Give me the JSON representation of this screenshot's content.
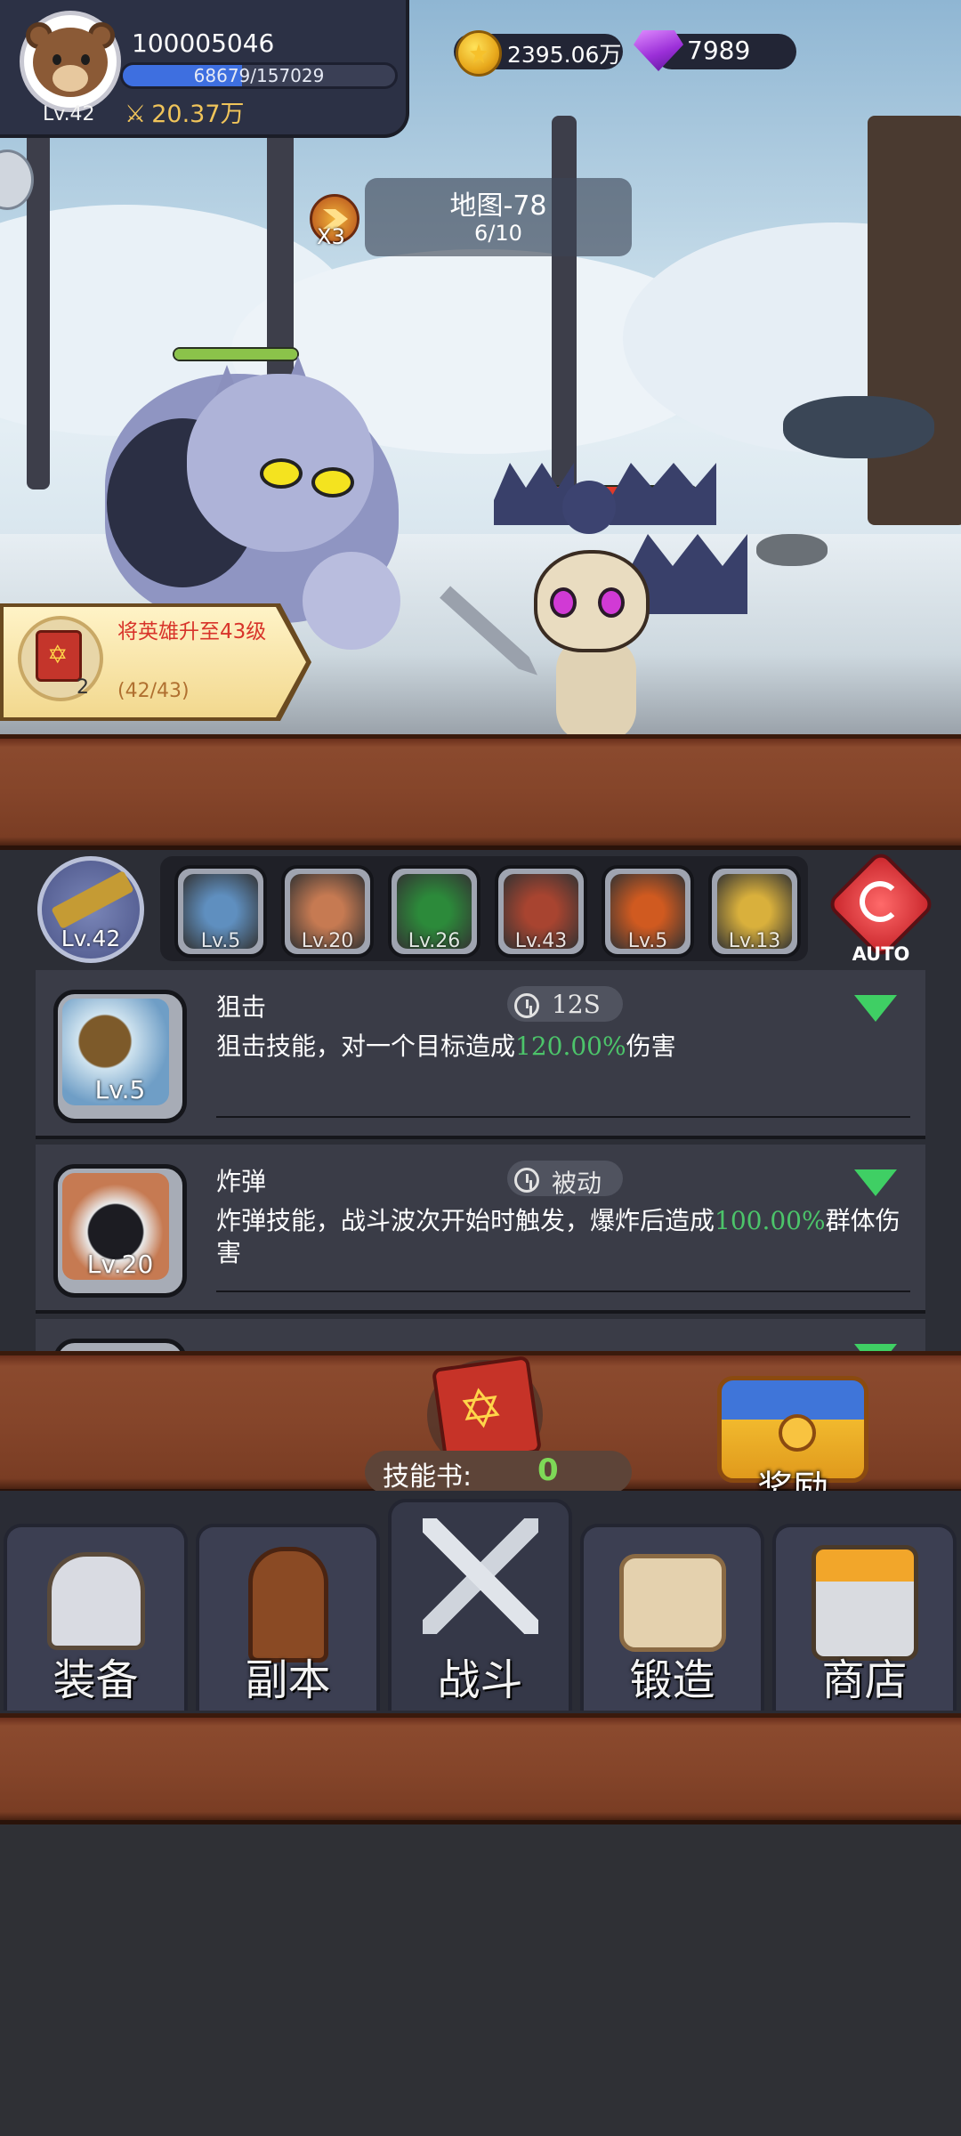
{
  "player": {
    "id": "100005046",
    "level": "Lv.42",
    "xp_text": "68679/157029",
    "xp_fraction": 0.437,
    "power": "20.37万"
  },
  "currency": {
    "gold": "2395.06万",
    "gems": "7989"
  },
  "battle": {
    "speed": "X3",
    "map_title": "地图-78",
    "wave_progress": "6/10",
    "hero_hp_fraction": 1.0,
    "enemy_hp_fraction": 0.55
  },
  "quest": {
    "title": "将英雄升至43级",
    "progress": "(42/43)",
    "reward_count": "2"
  },
  "skills": {
    "hero_level": "Lv.42",
    "auto_label": "AUTO",
    "slots": [
      {
        "level": "Lv.5",
        "art": "sniper-icon",
        "color": "#5f8fbf"
      },
      {
        "level": "Lv.20",
        "art": "bomb-icon",
        "color": "#c67a52"
      },
      {
        "level": "Lv.26",
        "art": "poison-icon",
        "color": "#2c8a3a"
      },
      {
        "level": "Lv.43",
        "art": "fire-demon-icon",
        "color": "#a84430"
      },
      {
        "level": "Lv.5",
        "art": "fireball-icon",
        "color": "#d05a20"
      },
      {
        "level": "Lv.13",
        "art": "lightning-icon",
        "color": "#d9b03c"
      }
    ],
    "cards": [
      {
        "name": "狙击",
        "cooldown": "12S",
        "level": "Lv.5",
        "desc_before": "狙击技能，对一个目标造成",
        "desc_value": "120.00%",
        "desc_after": "伤害"
      },
      {
        "name": "炸弹",
        "cooldown": "被动",
        "level": "Lv.20",
        "desc_before": "炸弹技能，战斗波次开始时触发，爆炸后造成",
        "desc_value": "100.00%",
        "desc_after": "群体伤害"
      }
    ]
  },
  "skill_book": {
    "label": "技能书:",
    "count": "0"
  },
  "reward": {
    "label": "奖励"
  },
  "nav": {
    "tabs": [
      {
        "label": "装备",
        "icon": "helmet-icon"
      },
      {
        "label": "副本",
        "icon": "dungeon-sword-icon"
      },
      {
        "label": "战斗",
        "icon": "crossed-swords-icon"
      },
      {
        "label": "锻造",
        "icon": "forge-scroll-icon"
      },
      {
        "label": "商店",
        "icon": "shop-icon"
      }
    ],
    "active": 2
  },
  "colors": {
    "accent_green": "#4cc46a",
    "xp_blue": "#3e6fe0",
    "wood": "#85452a",
    "panel": "#2c2e36"
  }
}
